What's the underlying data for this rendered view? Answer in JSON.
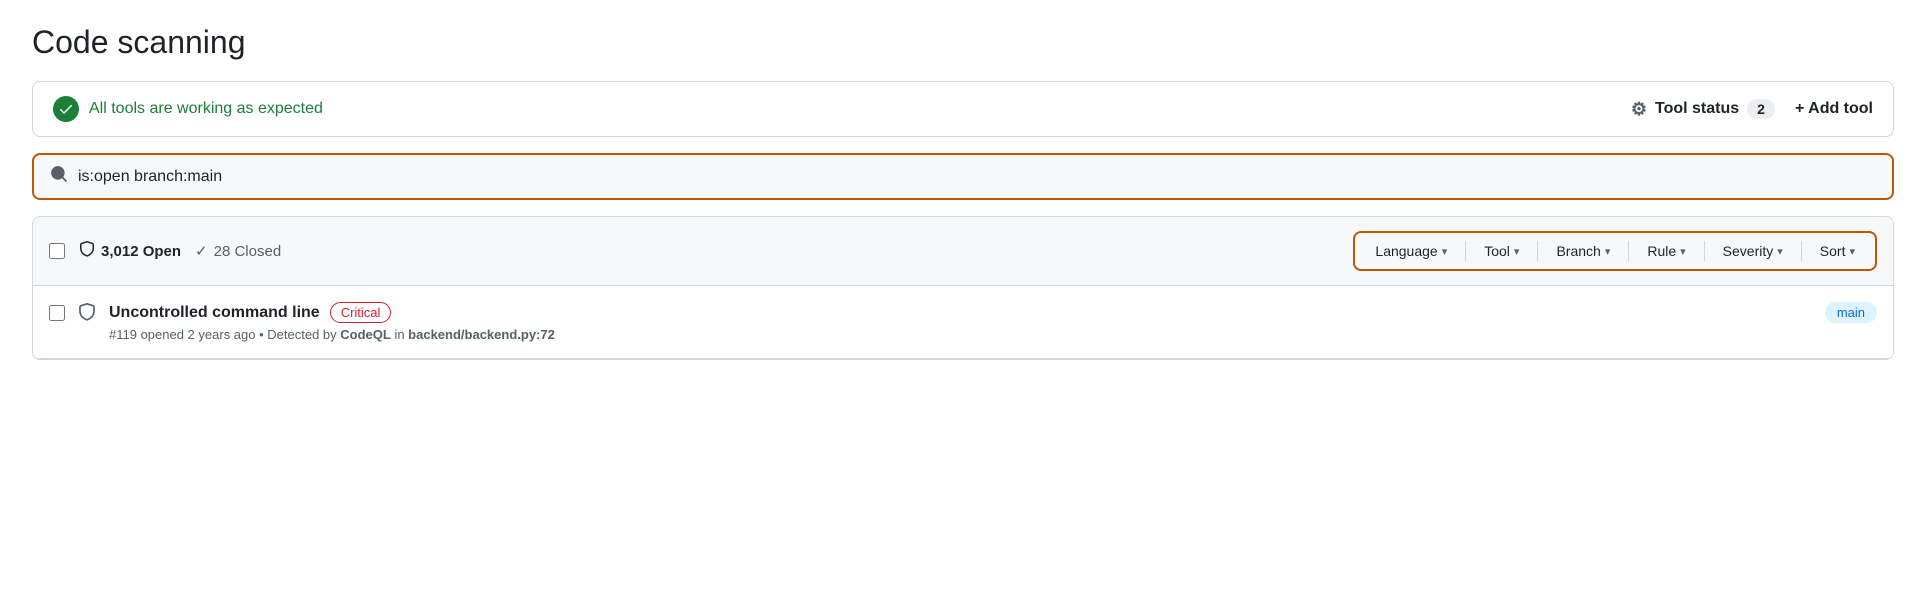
{
  "page": {
    "title": "Code scanning"
  },
  "status_bar": {
    "message": "All tools are working as expected",
    "tool_status_label": "Tool status",
    "tool_count": "2",
    "add_tool_label": "+ Add tool"
  },
  "search": {
    "value": "is:open branch:main",
    "placeholder": "is:open branch:main"
  },
  "results": {
    "open_count": "3,012 Open",
    "closed_count": "28 Closed",
    "filters": [
      {
        "label": "Language",
        "id": "language-filter"
      },
      {
        "label": "Tool",
        "id": "tool-filter"
      },
      {
        "label": "Branch",
        "id": "branch-filter"
      },
      {
        "label": "Rule",
        "id": "rule-filter"
      },
      {
        "label": "Severity",
        "id": "severity-filter"
      },
      {
        "label": "Sort",
        "id": "sort-filter"
      }
    ],
    "rows": [
      {
        "title": "Uncontrolled command line",
        "severity": "Critical",
        "meta": "#119 opened 2 years ago • Detected by CodeQL in backend/backend.py:72",
        "number": "#119",
        "age": "opened 2 years ago",
        "detected_by": "CodeQL",
        "filepath": "backend/backend.py:72",
        "branch": "main"
      }
    ]
  }
}
